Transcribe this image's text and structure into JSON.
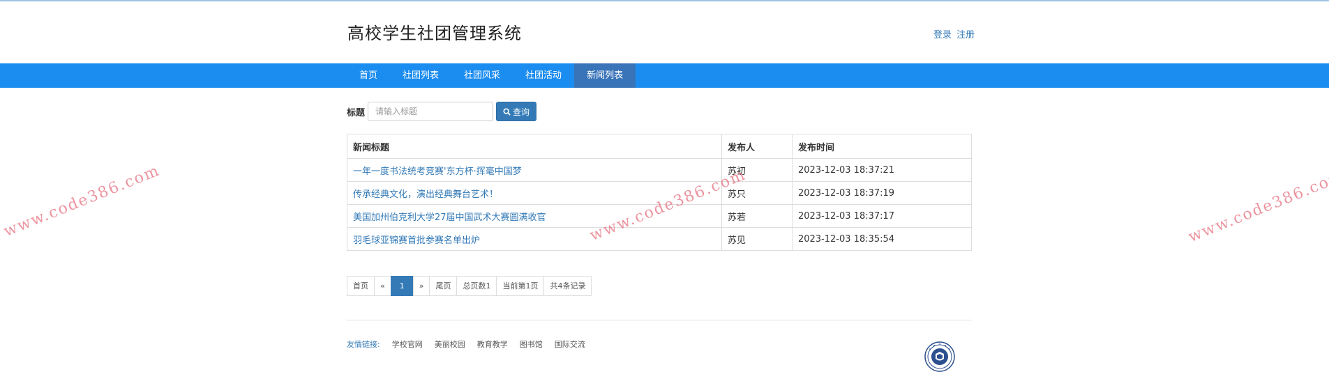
{
  "header": {
    "site_title": "高校学生社团管理系统",
    "login": "登录",
    "register": "注册"
  },
  "nav": {
    "items": [
      "首页",
      "社团列表",
      "社团风采",
      "社团活动",
      "新闻列表"
    ],
    "active": "新闻列表"
  },
  "search": {
    "label": "标题",
    "placeholder": "请输入标题",
    "value": "",
    "button": "查询"
  },
  "table": {
    "headers": [
      "新闻标题",
      "发布人",
      "发布时间"
    ],
    "rows": [
      [
        "一年一度书法统考竞赛'东方杯·挥毫中国梦",
        "苏初",
        "2023-12-03 18:37:21"
      ],
      [
        "传承经典文化，演出经典舞台艺术！",
        "苏只",
        "2023-12-03 18:37:19"
      ],
      [
        "美国加州伯克利大学27届中国武术大赛圆满收官",
        "苏若",
        "2023-12-03 18:37:17"
      ],
      [
        "羽毛球亚锦赛首批参赛名单出炉",
        "苏见",
        "2023-12-03 18:35:54"
      ]
    ]
  },
  "pagination": {
    "first": "首页",
    "prev": "«",
    "current": "1",
    "next": "»",
    "last": "尾页",
    "total_pages": "总页数1",
    "current_page": "当前第1页",
    "total_records": "共4条记录"
  },
  "footer": {
    "links_title": "友情链接:",
    "links": [
      "学校官网",
      "美丽校园",
      "教育教学",
      "图书馆",
      "国际交流"
    ]
  },
  "watermark": "www.code386.com",
  "colors": {
    "nav_bg": "#1b8cf0",
    "nav_active": "#3a74b8",
    "link": "#337ab7",
    "watermark": "#dc3c50"
  }
}
